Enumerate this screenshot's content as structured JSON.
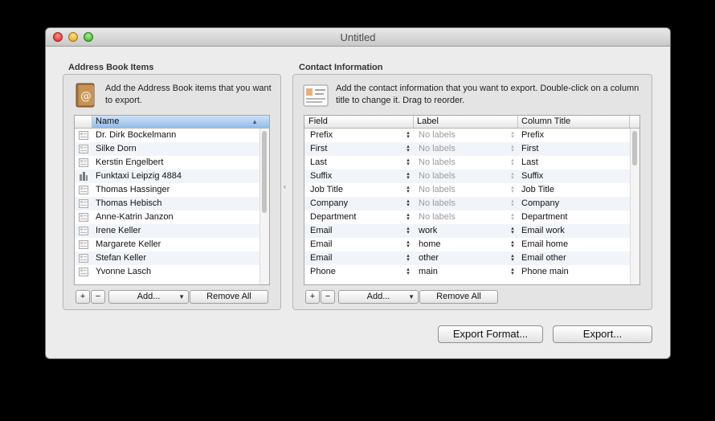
{
  "window": {
    "title": "Untitled"
  },
  "left": {
    "section_title": "Address Book Items",
    "description": "Add the Address Book items that you want to export.",
    "column": "Name",
    "rows": [
      {
        "name": "Dr. Dirk Bockelmann",
        "type": "person"
      },
      {
        "name": "Silke Dorn",
        "type": "person"
      },
      {
        "name": "Kerstin Engelbert",
        "type": "person"
      },
      {
        "name": "Funktaxi Leipzig 4884",
        "type": "company"
      },
      {
        "name": "Thomas Hassinger",
        "type": "person"
      },
      {
        "name": "Thomas Hebisch",
        "type": "person"
      },
      {
        "name": "Anne-Katrin Janzon",
        "type": "person"
      },
      {
        "name": "Irene Keller",
        "type": "person"
      },
      {
        "name": "Margarete Keller",
        "type": "person"
      },
      {
        "name": "Stefan Keller",
        "type": "person"
      },
      {
        "name": "Yvonne Lasch",
        "type": "person"
      }
    ],
    "buttons": {
      "plus": "+",
      "minus": "−",
      "add": "Add...",
      "remove_all": "Remove All"
    }
  },
  "right": {
    "section_title": "Contact Information",
    "description": "Add the contact information that you want to export. Double-click on a column title to change it. Drag to reorder.",
    "columns": {
      "field": "Field",
      "label": "Label",
      "title": "Column Title"
    },
    "rows": [
      {
        "field": "Prefix",
        "label": "No labels",
        "title": "Prefix"
      },
      {
        "field": "First",
        "label": "No labels",
        "title": "First"
      },
      {
        "field": "Last",
        "label": "No labels",
        "title": "Last"
      },
      {
        "field": "Suffix",
        "label": "No labels",
        "title": "Suffix"
      },
      {
        "field": "Job Title",
        "label": "No labels",
        "title": "Job Title"
      },
      {
        "field": "Company",
        "label": "No labels",
        "title": "Company"
      },
      {
        "field": "Department",
        "label": "No labels",
        "title": "Department"
      },
      {
        "field": "Email",
        "label": "work",
        "title": "Email work"
      },
      {
        "field": "Email",
        "label": "home",
        "title": "Email home"
      },
      {
        "field": "Email",
        "label": "other",
        "title": "Email other"
      },
      {
        "field": "Phone",
        "label": "main",
        "title": "Phone main"
      }
    ],
    "buttons": {
      "plus": "+",
      "minus": "−",
      "add": "Add...",
      "remove_all": "Remove All"
    }
  },
  "footer": {
    "export_format": "Export Format...",
    "export": "Export..."
  }
}
